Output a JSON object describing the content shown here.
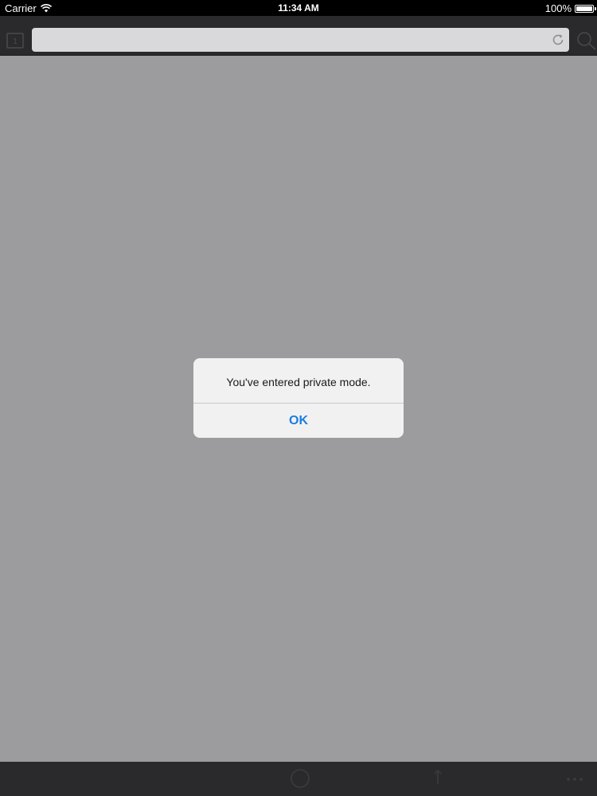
{
  "status_bar": {
    "carrier": "Carrier",
    "time": "11:34 AM",
    "battery": "100%",
    "battery_level": 1.0
  },
  "toolbar": {
    "tabs_icon": "tabs-icon",
    "reload_icon": "reload-icon",
    "right_icon": "bookmarks-icon"
  },
  "bottom_bar": {
    "home_icon": "home-icon",
    "share_icon": "share-icon",
    "more_icon": "more-icon"
  },
  "alert": {
    "message": "You've entered private mode.",
    "button_label": "OK"
  },
  "colors": {
    "status_bar_bg": "#000000",
    "toolbar_bg": "#2a2a2c",
    "address_bar_bg": "#d9d9db",
    "content_bg": "#9c9b9e",
    "alert_bg": "#f4f4f5",
    "accent": "#1b7ee0"
  }
}
